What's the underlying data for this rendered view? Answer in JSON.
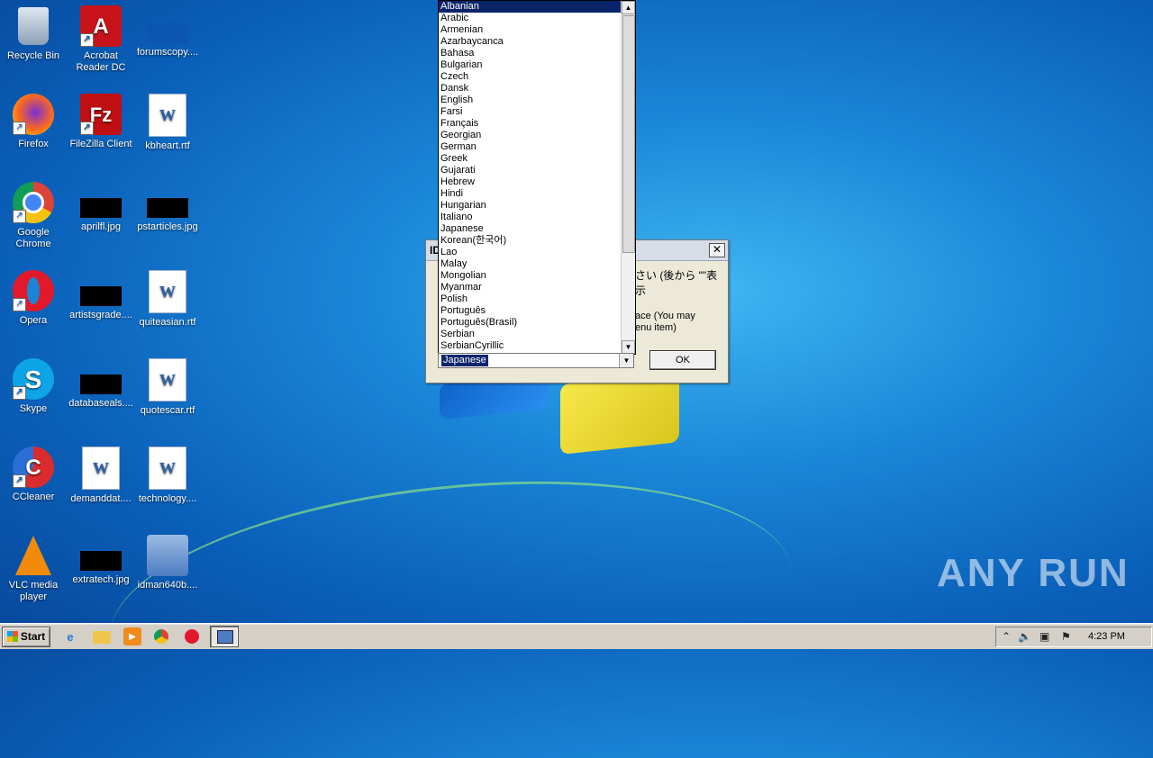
{
  "desktop": {
    "icons": [
      {
        "label": "Recycle Bin",
        "icon": "recycle-bin-icon"
      },
      {
        "label": "Acrobat Reader DC",
        "icon": "acrobat-reader-icon"
      },
      {
        "label": "forumscopy....",
        "icon": "image-file-icon"
      },
      {
        "label": "Firefox",
        "icon": "firefox-icon"
      },
      {
        "label": "FileZilla Client",
        "icon": "filezilla-icon"
      },
      {
        "label": "kbheart.rtf",
        "icon": "word-document-icon"
      },
      {
        "label": "Google Chrome",
        "icon": "chrome-icon"
      },
      {
        "label": "aprilfl.jpg",
        "icon": "image-file-icon"
      },
      {
        "label": "pstarticles.jpg",
        "icon": "image-file-icon"
      },
      {
        "label": "Opera",
        "icon": "opera-icon"
      },
      {
        "label": "artistsgrade....",
        "icon": "image-file-icon"
      },
      {
        "label": "quiteasian.rtf",
        "icon": "word-document-icon"
      },
      {
        "label": "Skype",
        "icon": "skype-icon"
      },
      {
        "label": "databaseals....",
        "icon": "image-file-icon"
      },
      {
        "label": "quotescar.rtf",
        "icon": "word-document-icon"
      },
      {
        "label": "CCleaner",
        "icon": "ccleaner-icon"
      },
      {
        "label": "demanddat....",
        "icon": "word-document-icon"
      },
      {
        "label": "technology....",
        "icon": "word-document-icon"
      },
      {
        "label": "VLC media player",
        "icon": "vlc-icon"
      },
      {
        "label": "extratech.jpg",
        "icon": "image-file-icon"
      },
      {
        "label": "idman640b....",
        "icon": "installer-icon"
      }
    ]
  },
  "dialog": {
    "title": "ID",
    "message_jp": "さい (後から \"\"表示",
    "message_en_line1": "ace (You may",
    "message_en_line2": "enu item)",
    "ok_label": "OK",
    "close_symbol": "✕"
  },
  "language_dropdown": {
    "items": [
      "Albanian",
      "Arabic",
      "Armenian",
      "Azarbaycanca",
      "Bahasa",
      "Bulgarian",
      "Czech",
      "Dansk",
      "English",
      "Farsi",
      "Français",
      "Georgian",
      "German",
      "Greek",
      "Gujarati",
      "Hebrew",
      "Hindi",
      "Hungarian",
      "Italiano",
      "Japanese",
      "Korean(한국어)",
      "Lao",
      "Malay",
      "Mongolian",
      "Myanmar",
      "Polish",
      "Português",
      "Português(Brasil)",
      "Serbian",
      "SerbianCyrillic"
    ],
    "highlighted": "Albanian",
    "selected_value": "Japanese"
  },
  "taskbar": {
    "start_label": "Start",
    "clock": "4:23 PM"
  },
  "watermark": "ANY RUN"
}
